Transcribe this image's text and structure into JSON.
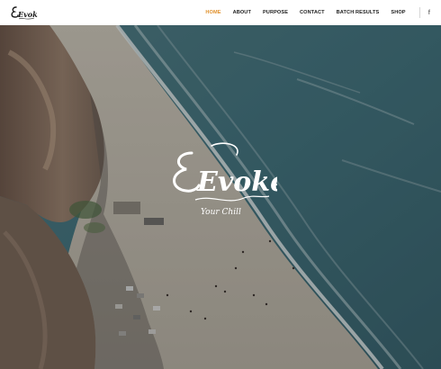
{
  "header": {
    "logo": {
      "text": "Evoke",
      "icon": "evoke-script-logo"
    },
    "nav": [
      {
        "label": "HOME",
        "active": true
      },
      {
        "label": "ABOUT",
        "active": false
      },
      {
        "label": "PURPOSE",
        "active": false
      },
      {
        "label": "CONTACT",
        "active": false
      },
      {
        "label": "BATCH RESULTS",
        "active": false
      },
      {
        "label": "SHOP",
        "active": false
      }
    ],
    "social": {
      "facebook_glyph": "f",
      "icon": "facebook-icon"
    }
  },
  "hero": {
    "image": "aerial beach and cliffs",
    "logo_text": "Evoke",
    "tagline": "Your Chill"
  },
  "colors": {
    "accent": "#e0912c",
    "nav_text": "#222222",
    "ocean": "#3f6f78",
    "sand": "#c4bcae",
    "cliff": "#8a6e5c"
  }
}
